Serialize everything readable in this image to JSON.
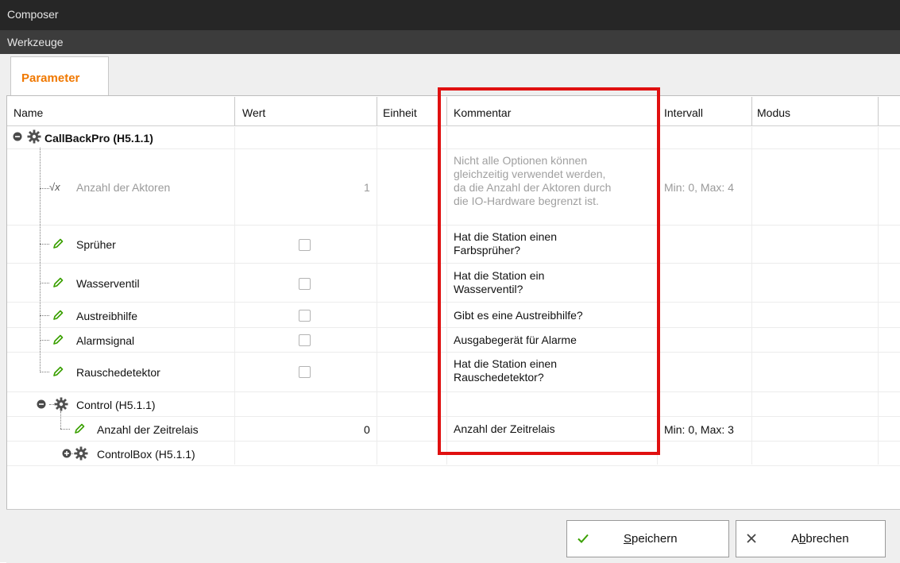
{
  "window": {
    "title": "Composer",
    "menu": "Werkzeuge"
  },
  "tab": {
    "label": "Parameter"
  },
  "columns": {
    "name": "Name",
    "wert": "Wert",
    "einheit": "Einheit",
    "kommentar": "Kommentar",
    "intervall": "Intervall",
    "modus": "Modus"
  },
  "rows": [
    {
      "name": "CallBackPro (H5.1.1)",
      "icon": "gear-icon",
      "expander": "collapse"
    },
    {
      "name": "Anzahl der Aktoren",
      "icon": "sqrt-x-icon",
      "value": "1",
      "comment": [
        "Nicht alle Optionen können",
        "gleichzeitig verwendet werden,",
        "da die Anzahl der Aktoren durch",
        "die IO-Hardware begrenzt ist."
      ],
      "interval": "Min: 0, Max: 4",
      "disabled": true
    },
    {
      "name": "Sprüher",
      "icon": "pencil-icon",
      "checked": false,
      "comment": [
        "Hat die Station einen",
        "Farbsprüher?"
      ]
    },
    {
      "name": "Wasserventil",
      "icon": "pencil-icon",
      "checked": false,
      "comment": [
        "Hat die Station ein",
        "Wasserventil?"
      ]
    },
    {
      "name": "Austreibhilfe",
      "icon": "pencil-icon",
      "checked": false,
      "comment": [
        "Gibt es eine Austreibhilfe?"
      ]
    },
    {
      "name": "Alarmsignal",
      "icon": "pencil-icon",
      "checked": false,
      "comment": [
        "Ausgabegerät für Alarme"
      ]
    },
    {
      "name": "Rauschedetektor",
      "icon": "pencil-icon",
      "checked": false,
      "comment": [
        "Hat die Station einen",
        "Rauschedetektor?"
      ]
    },
    {
      "name": "Control (H5.1.1)",
      "icon": "gear-icon",
      "expander": "collapse"
    },
    {
      "name": "Anzahl der Zeitrelais",
      "icon": "pencil-icon",
      "value": "0",
      "comment": [
        "Anzahl der Zeitrelais"
      ],
      "interval": "Min: 0, Max: 3"
    },
    {
      "name": "ControlBox (H5.1.1)",
      "icon": "gear-icon",
      "expander": "expand"
    }
  ],
  "buttons": {
    "save": {
      "pre": "",
      "mnemonic": "S",
      "post": "peichern",
      "icon": "check-icon"
    },
    "cancel": {
      "pre": "A",
      "mnemonic": "b",
      "post": "brechen",
      "icon": "x-icon"
    }
  },
  "colors": {
    "accent": "#f07800",
    "highlight": "#e01010",
    "check": "#3aa000",
    "pencil": "#3aa000"
  }
}
